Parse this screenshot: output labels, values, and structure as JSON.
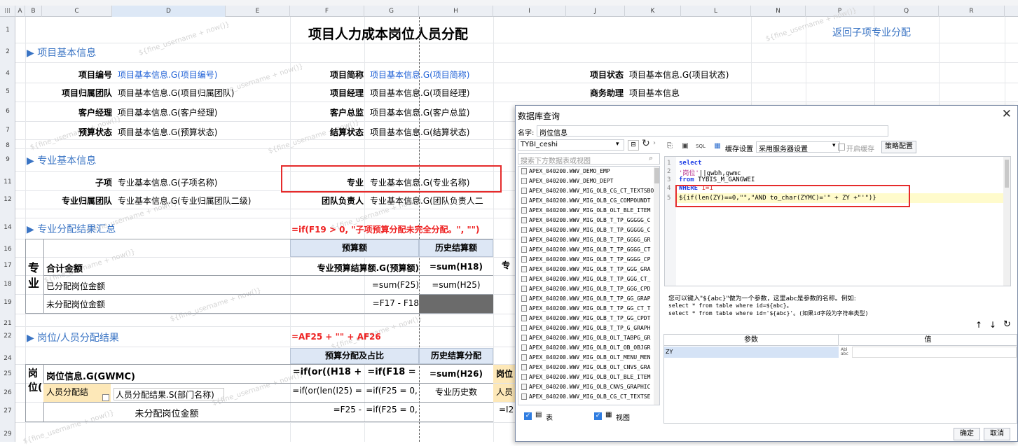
{
  "spreadsheet": {
    "col_headers": [
      "A",
      "B",
      "C",
      "D",
      "E",
      "F",
      "G",
      "H",
      "I",
      "J",
      "K",
      "L",
      "N",
      "P",
      "Q",
      "R"
    ],
    "row_headers": [
      "1",
      "2",
      "4",
      "5",
      "6",
      "7",
      "8",
      "9",
      "11",
      "12",
      "14",
      "16",
      "17",
      "18",
      "19",
      "21",
      "22",
      "24",
      "25",
      "26",
      "27",
      "29"
    ],
    "title": "项目人力成本岗位人员分配",
    "back_link": "返回子项专业分配",
    "sections": {
      "basic_info": "▶ 项目基本信息",
      "major_info": "▶ 专业基本信息",
      "major_summary": "▶ 专业分配结果汇总",
      "post_result": "▶ 岗位/人员分配结果"
    },
    "basic_fields": [
      {
        "label": "项目编号",
        "value": "项目基本信息.G(项目编号)"
      },
      {
        "label": "项目简称",
        "value": "项目基本信息.G(项目简称)"
      },
      {
        "label": "项目状态",
        "value": "项目基本信息.G(项目状态)"
      },
      {
        "label": "项目归属团队",
        "value": "项目基本信息.G(项目归属团队)"
      },
      {
        "label": "项目经理",
        "value": "项目基本信息.G(项目经理)"
      },
      {
        "label": "商务助理",
        "value": "项目基本信息"
      },
      {
        "label": "客户经理",
        "value": "项目基本信息.G(客户经理)"
      },
      {
        "label": "客户总监",
        "value": "项目基本信息.G(客户总监)"
      },
      {
        "label": "预算状态",
        "value": "项目基本信息.G(预算状态)"
      },
      {
        "label": "结算状态",
        "value": "项目基本信息.G(结算状态)"
      }
    ],
    "major_fields": [
      {
        "label": "子项",
        "value": "专业基本信息.G(子项名称)"
      },
      {
        "label": "专业",
        "value": "专业基本信息.G(专业名称)"
      },
      {
        "label": "专业归属团队",
        "value": "专业基本信息.G(专业归属团队二级)"
      },
      {
        "label": "团队负责人",
        "value": "专业基本信息.G(团队负责人二"
      }
    ],
    "formula_f14": "=if(F19 > 0, \"子项预算分配未完全分配。\", \"\")",
    "summary": {
      "col_budget": "预算额",
      "col_history": "历史结算额",
      "side_label": "专业",
      "row17_label": "合计金额",
      "row17_f": "专业预算结算额.G(预算额)",
      "row17_h": "=sum(H18)",
      "row17_i": "专",
      "row18_label": "已分配岗位金额",
      "row18_f": "=sum(F25)",
      "row18_h": "=sum(H25)",
      "row19_label": "未分配岗位金额",
      "row19_f": "=F17 - F18"
    },
    "formula_f22": "=AF25 + \"\" + AF26",
    "post": {
      "col_budget_ratio": "预算分配及占比",
      "col_history": "历史结算分配",
      "side_label": "岗位(",
      "row25_c": "岗位信息.G(GWMC)",
      "row25_f": "=if(or((H18 +",
      "row25_g": "=if(F18 =",
      "row25_h": "=sum(H26)",
      "row25_i": "岗位",
      "row26_c1": "人员分配结",
      "row26_c2": "人员分配结果.S(部门名称)",
      "row26_f": "=if(or(len(I25) =",
      "row26_g": "=if(F25 = 0,",
      "row26_h": "专业历史数",
      "row26_i": "人员",
      "row27_label": "未分配岗位金额",
      "row27_f": "=F25 -",
      "row27_g": "=if(F25 = 0,",
      "row27_h": "=I2"
    },
    "watermark": "${fine_username + now()}"
  },
  "dialog": {
    "title": "数据库查询",
    "name_label": "名字:",
    "name_value": "岗位信息",
    "connection": "TYBI_ceshi",
    "search_placeholder": "搜索下方数据表或视图",
    "tables": [
      "APEX_040200.WWV_DEMO_EMP",
      "APEX_040200.WWV_DEMO_DEPT",
      "APEX_040200.WWV_MIG_OLB_CG_CT_TEXTSBO",
      "APEX_040200.WWV_MIG_OLB_CG_COMPOUNDT",
      "APEX_040200.WWV_MIG_OLB_OLT_BLE_ITEM",
      "APEX_040200.WWV_MIG_OLB_T_TP_GGGGG_C",
      "APEX_040200.WWV_MIG_OLB_T_TP_GGGGG_C",
      "APEX_040200.WWV_MIG_OLB_T_TP_GGGG_GR",
      "APEX_040200.WWV_MIG_OLB_T_TP_GGGG_CT",
      "APEX_040200.WWV_MIG_OLB_T_TP_GGGG_CP",
      "APEX_040200.WWV_MIG_OLB_T_TP_GGG_GRA",
      "APEX_040200.WWV_MIG_OLB_T_TP_GGG_CT_",
      "APEX_040200.WWV_MIG_OLB_T_TP_GGG_CPD",
      "APEX_040200.WWV_MIG_OLB_T_TP_GG_GRAP",
      "APEX_040200.WWV_MIG_OLB_T_TP_GG_CT_T",
      "APEX_040200.WWV_MIG_OLB_T_TP_GG_CPDT",
      "APEX_040200.WWV_MIG_OLB_T_TP_G_GRAPH",
      "APEX_040200.WWV_MIG_OLB_OLT_TABPG_GR",
      "APEX_040200.WWV_MIG_OLB_OLT_OB_OBJGR",
      "APEX_040200.WWV_MIG_OLB_OLT_MENU_MEN",
      "APEX_040200.WWV_MIG_OLB_OLT_CNVS_GRA",
      "APEX_040200.WWV_MIG_OLB_OLT_BLE_ITEM",
      "APEX_040200.WWV_MIG_OLB_CNVS_GRAPHIC",
      "APEX_040200.WWV_MIG_OLB_CG_CT_TEXTSE"
    ],
    "chk_table": "表",
    "chk_view": "视图",
    "cache_label": "缓存设置",
    "cache_select": "采用服务器设置",
    "open_cache": "开启缓存",
    "strategy_btn": "策略配置",
    "sql_lines": [
      {
        "n": "1",
        "parts": [
          {
            "t": "select",
            "c": "kw"
          }
        ]
      },
      {
        "n": "2",
        "parts": [
          {
            "t": "'岗位'",
            "c": "str"
          },
          {
            "t": "||gwbh,gwmc",
            "c": ""
          }
        ]
      },
      {
        "n": "3",
        "parts": [
          {
            "t": "from",
            "c": "kw"
          },
          {
            "t": " TYBIS_M_GANGWEI",
            "c": ""
          }
        ]
      },
      {
        "n": "4",
        "parts": [
          {
            "t": "WHERE",
            "c": "kw"
          },
          {
            "t": " 1=1",
            "c": "num"
          }
        ]
      },
      {
        "n": "5",
        "parts": [
          {
            "t": " ${if(len(ZY)==0,\"\",\"AND to_char(ZYMC)='\" + ZY +\"'\")}",
            "c": ""
          }
        ]
      }
    ],
    "hint1": "您可以键入\"${abc}\"做为一个参数，这里abc是参数的名称。例如:",
    "hint2": "select * from table where id=${abc}。",
    "hint3": "select * from table where id='${abc}'。(如果id字段为字符串类型)",
    "param_col": "参数",
    "value_col": "值",
    "param_row": "ZY",
    "ok": "确定",
    "cancel": "取消"
  }
}
